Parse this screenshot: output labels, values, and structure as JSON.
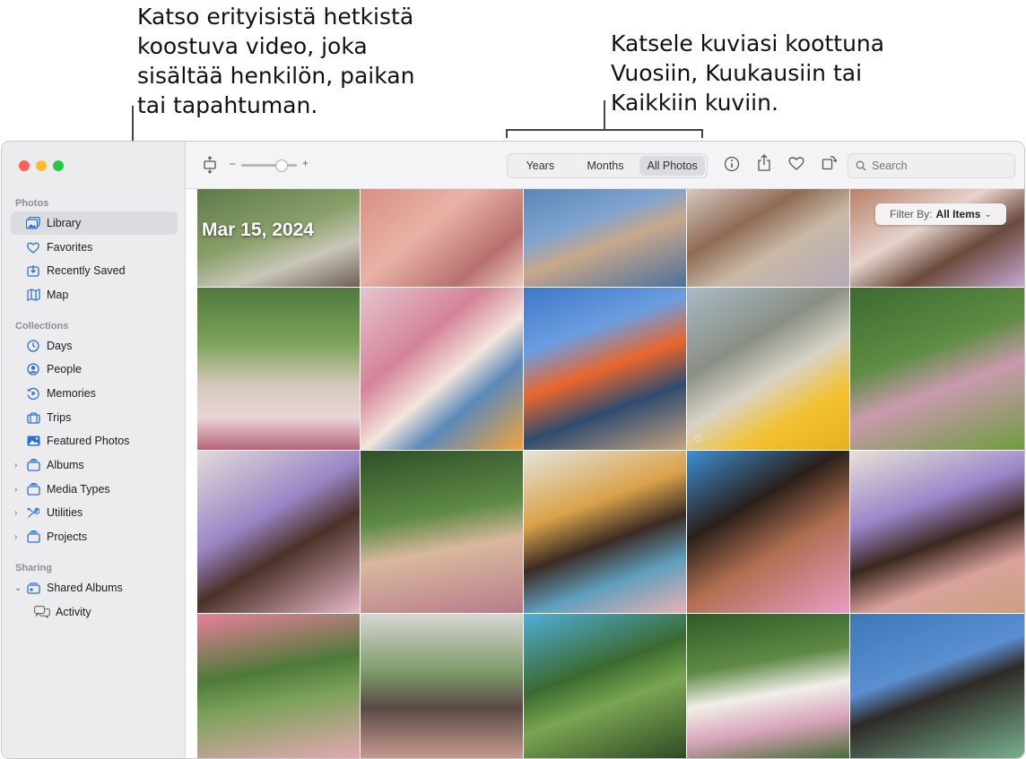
{
  "callouts": {
    "left": "Katso erityisistä hetkistä\nkoostuva video, joka\nsisältää henkilön, paikan\ntai tapahtuman.",
    "right": "Katsele kuviasi koottuna\nVuosiin, Kuukausiin tai\nKaikkiin kuviin."
  },
  "sidebar": {
    "sections": {
      "photos": "Photos",
      "collections": "Collections",
      "sharing": "Sharing"
    },
    "items": [
      {
        "label": "Library",
        "icon": "library-icon",
        "selected": true
      },
      {
        "label": "Favorites",
        "icon": "heart-icon"
      },
      {
        "label": "Recently Saved",
        "icon": "download-icon"
      },
      {
        "label": "Map",
        "icon": "map-icon"
      },
      {
        "label": "Days",
        "icon": "clock-icon"
      },
      {
        "label": "People",
        "icon": "person-circle-icon"
      },
      {
        "label": "Memories",
        "icon": "memories-icon"
      },
      {
        "label": "Trips",
        "icon": "suitcase-icon"
      },
      {
        "label": "Featured Photos",
        "icon": "photo-icon"
      },
      {
        "label": "Albums",
        "icon": "stack-icon"
      },
      {
        "label": "Media Types",
        "icon": "stack-icon"
      },
      {
        "label": "Utilities",
        "icon": "tools-icon"
      },
      {
        "label": "Projects",
        "icon": "stack-icon"
      },
      {
        "label": "Shared Albums",
        "icon": "shared-stack-icon"
      },
      {
        "label": "Activity",
        "icon": "chat-icon"
      }
    ]
  },
  "toolbar": {
    "zoom_minus": "–",
    "zoom_plus": "+",
    "views": [
      "Years",
      "Months",
      "All Photos"
    ],
    "active_view": "All Photos",
    "search_placeholder": "Search"
  },
  "grid": {
    "date": "Mar 15, 2024",
    "filter_label": "Filter By:",
    "filter_value": "All Items"
  },
  "colors": {
    "accent": "#2a6fdb",
    "close": "#ff5f57",
    "minimize": "#febc2e",
    "zoom": "#28c840"
  }
}
